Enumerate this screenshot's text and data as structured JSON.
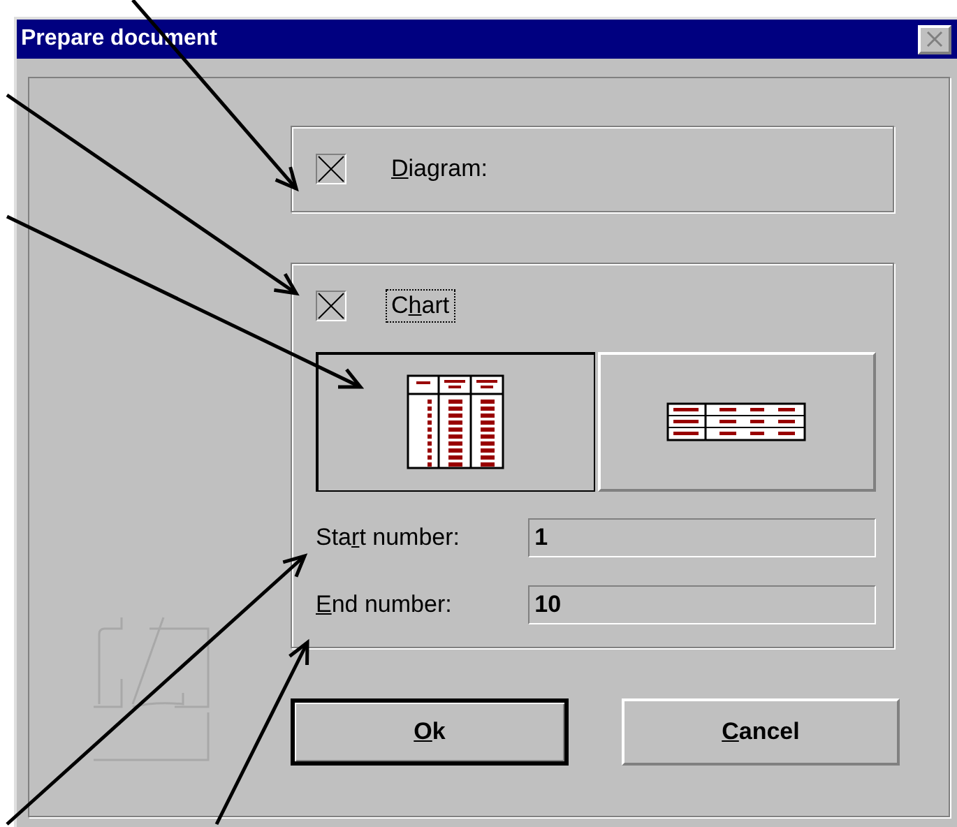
{
  "window": {
    "title": "Prepare document"
  },
  "diagram": {
    "label": {
      "key": "D",
      "post": "iagram:"
    },
    "checked": true
  },
  "chart": {
    "label": {
      "pre": "C",
      "key": "h",
      "post": "art"
    },
    "checked": true,
    "focused": true,
    "layouts": [
      {
        "kind": "vertical",
        "selected": true
      },
      {
        "kind": "horizontal",
        "selected": false
      }
    ],
    "fields": [
      {
        "label": {
          "pre": "Sta",
          "key": "r",
          "post": "t number:"
        },
        "value": "1"
      },
      {
        "label": {
          "key": "E",
          "post": "nd number:"
        },
        "value": "10"
      }
    ]
  },
  "buttons": [
    {
      "label": {
        "key": "O",
        "post": "k"
      },
      "default": true
    },
    {
      "label": {
        "key": "C",
        "post": "ancel"
      },
      "default": false
    }
  ]
}
